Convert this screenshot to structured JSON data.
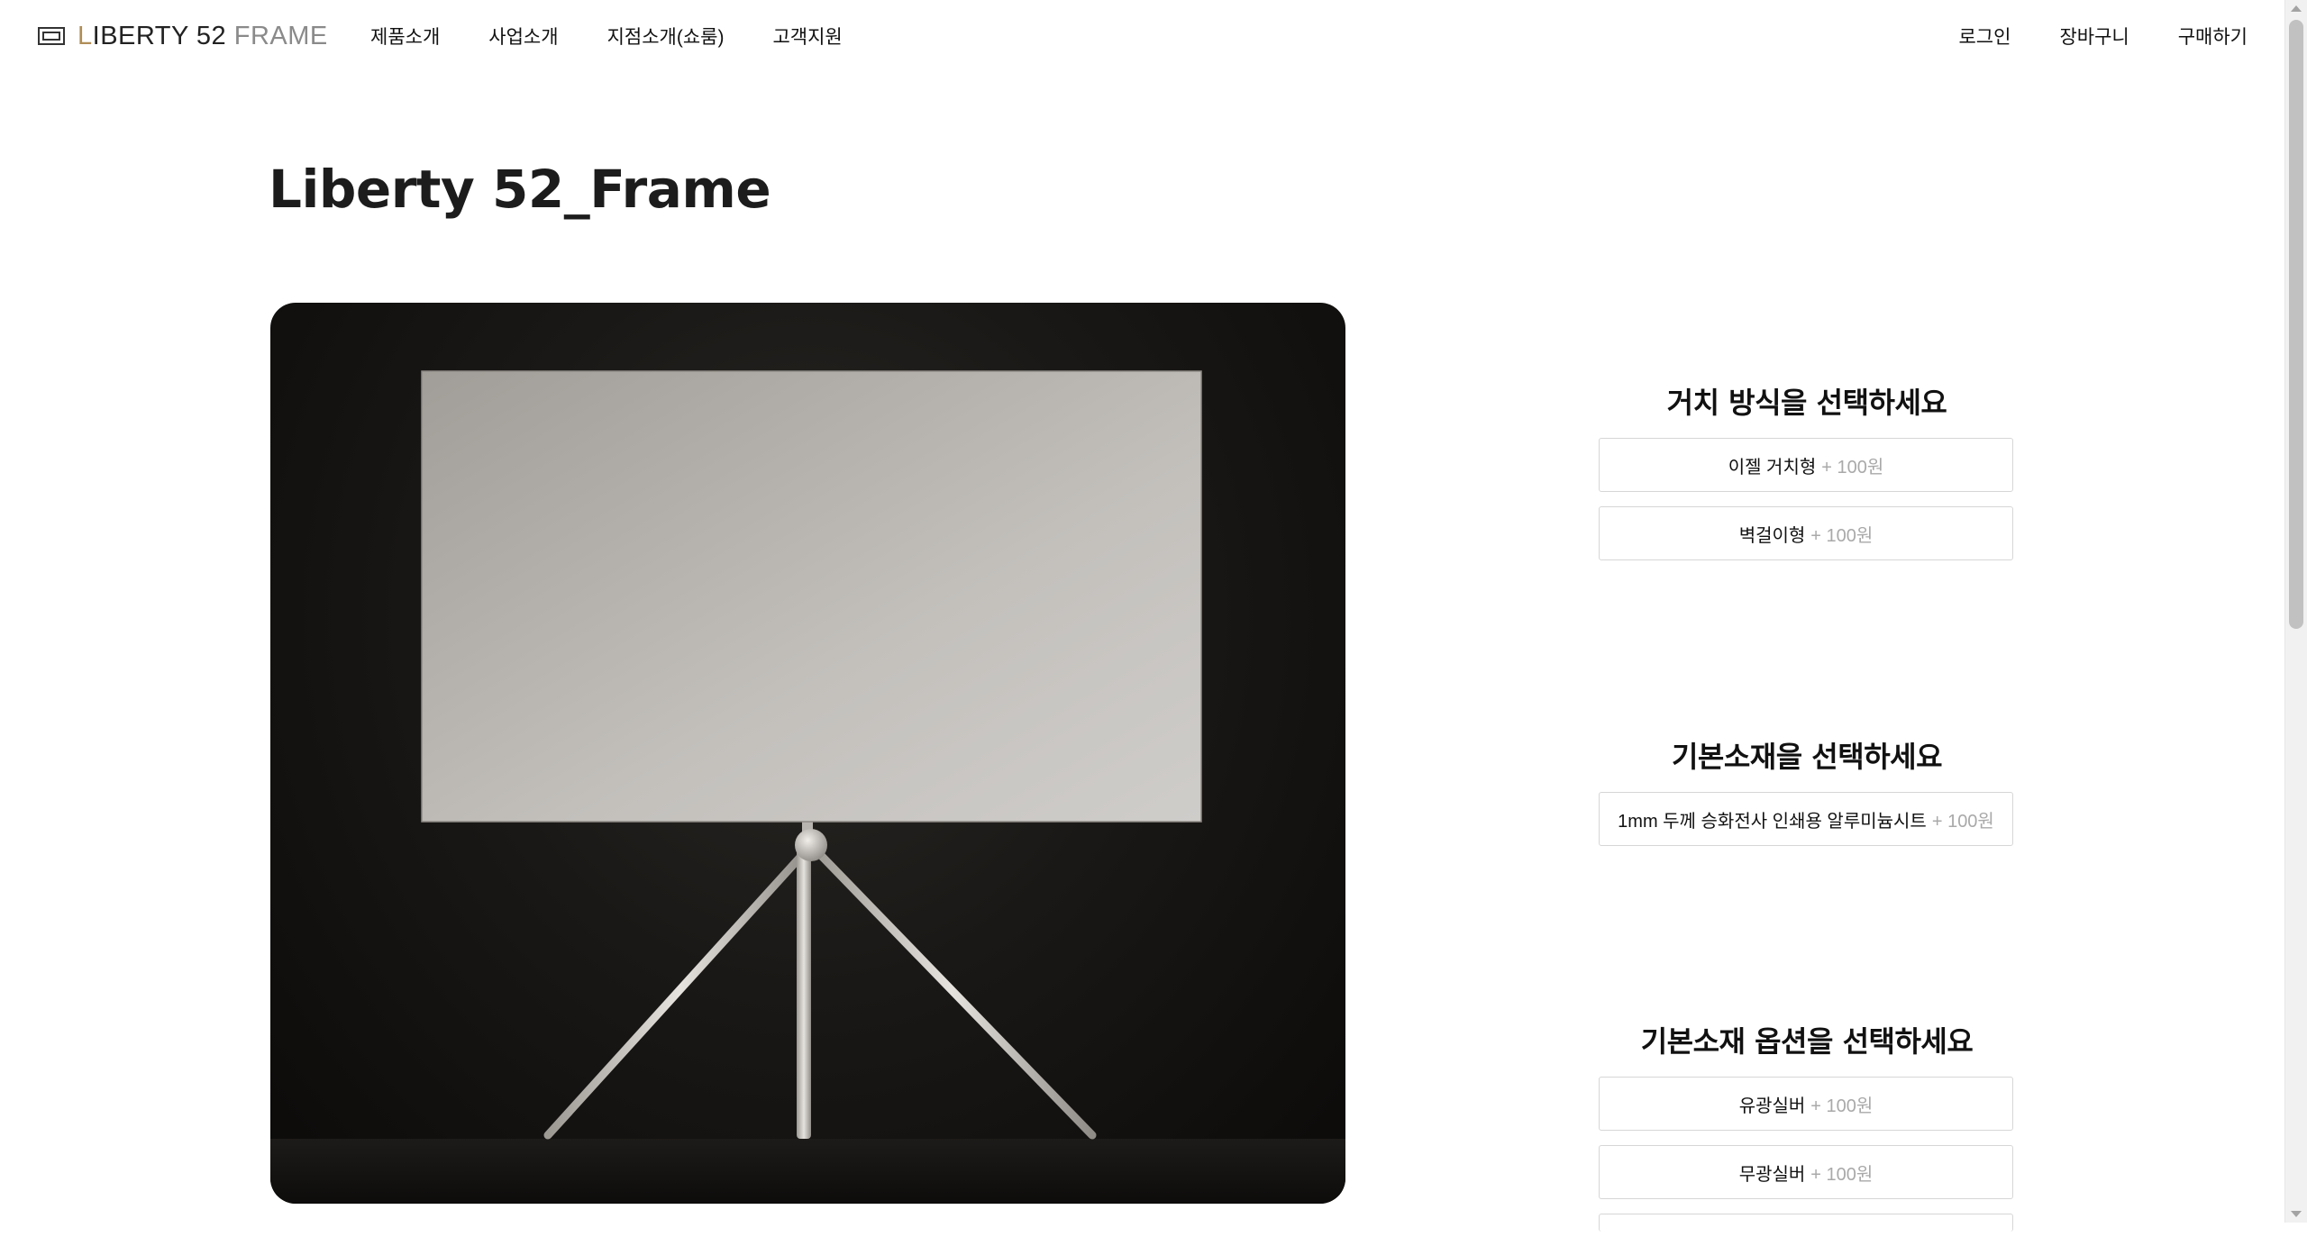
{
  "header": {
    "logo": {
      "part1": "L",
      "part2": "IBERTY 52 ",
      "part3": "F",
      "part4": "RAME"
    },
    "nav_left": [
      "제품소개",
      "사업소개",
      "지점소개(쇼룸)",
      "고객지원"
    ],
    "nav_right": [
      "로그인",
      "장바구니",
      "구매하기"
    ]
  },
  "page": {
    "title": "Liberty 52_Frame"
  },
  "options": {
    "mount": {
      "title": "거치 방식을 선택하세요",
      "items": [
        {
          "label": "이젤 거치형",
          "price": "+ 100원"
        },
        {
          "label": "벽걸이형",
          "price": "+ 100원"
        }
      ]
    },
    "material": {
      "title": "기본소재을 선택하세요",
      "items": [
        {
          "label": "1mm 두께 승화전사 인쇄용 알루미늄시트",
          "price": "+ 100원"
        }
      ]
    },
    "material_option": {
      "title": "기본소재 옵션을 선택하세요",
      "items": [
        {
          "label": "유광실버",
          "price": "+ 100원"
        },
        {
          "label": "무광실버",
          "price": "+ 100원"
        }
      ]
    }
  },
  "icons": {
    "logo": "frame-logo-icon"
  },
  "colors": {
    "accent": "#b08d57",
    "price": "#a9a9a9",
    "border": "#d6d6d6"
  }
}
